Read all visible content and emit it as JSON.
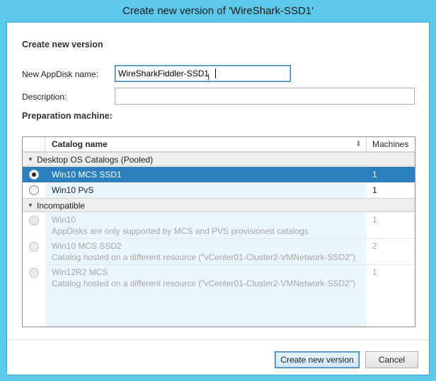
{
  "window": {
    "title": "Create new version of 'WireShark-SSD1'"
  },
  "form": {
    "heading": "Create new version",
    "appdisk_name_label": "New AppDisk name:",
    "appdisk_name_value": "WireSharkFiddler-SSD1",
    "description_label": "Description:",
    "description_value": "",
    "preparation_label": "Preparation machine:"
  },
  "grid": {
    "columns": {
      "name": "Catalog name",
      "machines": "Machines"
    },
    "groups": [
      {
        "label": "Desktop OS Catalogs (Pooled)",
        "rows": [
          {
            "name": "Win10 MCS SSD1",
            "machines": "1",
            "selected": true
          },
          {
            "name": "Win10 PvS",
            "machines": "1",
            "selected": false
          }
        ]
      },
      {
        "label": "Incompatible",
        "rows": [
          {
            "name": "Win10",
            "detail": "AppDisks are only supported by MCS and PVS provisioned catalogs",
            "machines": "1"
          },
          {
            "name": "Win10 MCS SSD2",
            "detail": "Catalog hosted on a different resource (\"vCenter01-Cluster2-VMNetwork-SSD2\")",
            "machines": "2"
          },
          {
            "name": "Win12R2 MCS",
            "detail": "Catalog hosted on a different resource (\"vCenter01-Cluster2-VMNetwork-SSD2\")",
            "machines": "1"
          }
        ]
      }
    ]
  },
  "buttons": {
    "create": "Create new version",
    "cancel": "Cancel"
  },
  "icons": {
    "sort": "sort-arrow-down-icon",
    "expand": "triangle-down-icon"
  },
  "colors": {
    "titlebar": "#5ec8ea",
    "selection": "#2b7fbd",
    "band": "#eaf5fc"
  }
}
